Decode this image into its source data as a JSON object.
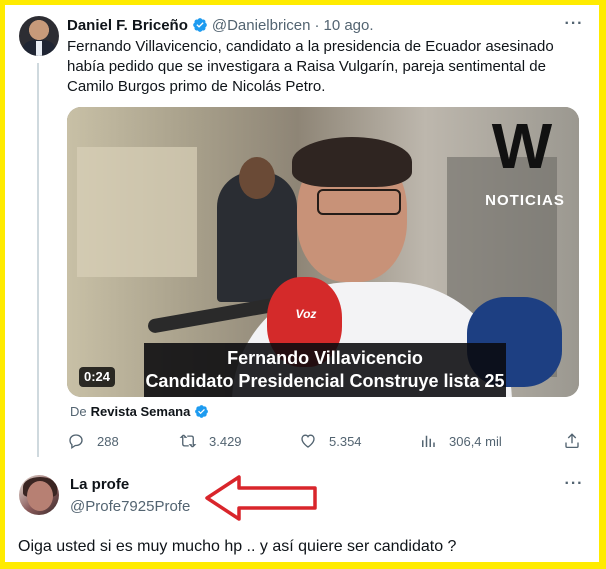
{
  "tweet": {
    "author_name": "Daniel F. Briceño",
    "handle": "@Danielbricen",
    "separator": "·",
    "date": "10 ago.",
    "text": "Fernando Villavicencio, candidato a la presidencia de Ecuador asesinado había pedido que se investigara a Raisa Vulgarín, pareja sentimental de Camilo Burgos primo de Nicolás Petro.",
    "more_icon": "more-horizontal-icon",
    "video": {
      "duration": "0:24",
      "caption_line1": "Fernando Villavicencio",
      "caption_line2": "Candidato Presidencial Construye lista 25",
      "logo_letter": "W",
      "logo_text": "NOTICIAS",
      "mic_text": "Voz"
    },
    "source_prefix": "De",
    "source_name": "Revista Semana",
    "stats": {
      "replies": "288",
      "retweets": "3.429",
      "likes": "5.354",
      "views": "306,4 mil"
    }
  },
  "reply": {
    "name": "La profe",
    "handle": "@Profe7925Profe"
  },
  "comment": "Oiga usted si es muy mucho hp .. y así quiere ser candidato ?",
  "colors": {
    "border": "#ffeb00",
    "verified": "#1d9bf0",
    "muted": "#536471",
    "arrow": "#d9252b"
  }
}
